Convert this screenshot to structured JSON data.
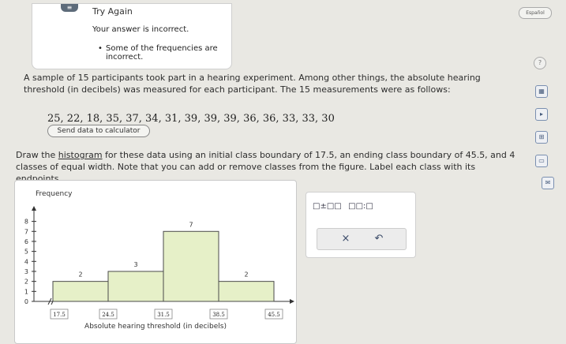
{
  "feedback": {
    "title": "Try Again",
    "message": "Your answer is incorrect.",
    "bullet": "Some of the frequencies are incorrect."
  },
  "language_button": "Español",
  "problem": {
    "text": "A sample of 15 participants took part in a hearing experiment. Among other things, the absolute hearing threshold (in decibels) was measured for each participant. The 15 measurements were as follows:",
    "data": "25, 22, 18, 35, 37, 34, 31, 39, 39, 39, 36, 36, 33, 33, 30",
    "send_button": "Send data to calculator",
    "instruction_before": "Draw the ",
    "instruction_link": "histogram",
    "instruction_after": " for these data using an initial class boundary of 17.5, an ending class boundary of 45.5, and 4 classes of equal width. Note that you can add or remove classes from the figure. Label each class with its endpoints."
  },
  "graph": {
    "y_title": "Frequency",
    "x_title": "Absolute hearing threshold (in decibels)"
  },
  "tools": {
    "symbol1": "□±□□",
    "symbol2": "□□:□",
    "clear": "×",
    "undo": "↶"
  },
  "chart_data": {
    "type": "bar",
    "title": "",
    "xlabel": "Absolute hearing threshold (in decibels)",
    "ylabel": "Frequency",
    "categories": [
      "17.5-24.5",
      "24.5-31.5",
      "31.5-38.5",
      "38.5-45.5"
    ],
    "bin_edges": [
      17.5,
      24.5,
      31.5,
      38.5,
      45.5
    ],
    "values": [
      2,
      3,
      7,
      2
    ],
    "y_ticks": [
      0,
      1,
      2,
      3,
      4,
      5,
      6,
      7,
      8
    ],
    "ylim": [
      0,
      8.6
    ],
    "colors": {
      "bar_fill": "#e6f0c8",
      "bar_stroke": "#4a4a4a",
      "axis": "#333333"
    }
  }
}
